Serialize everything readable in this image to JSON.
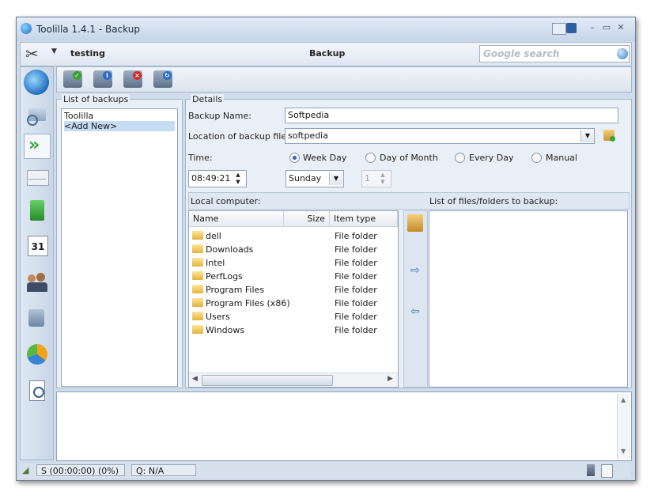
{
  "window": {
    "title": "Toolilla 1.4.1 - Backup",
    "controls": [
      "minimize",
      "maximize",
      "close"
    ]
  },
  "toolbar": {
    "profile": "testing",
    "section": "Backup",
    "search_placeholder": "Google search"
  },
  "nav": {
    "icons": [
      "app-logo-icon",
      "system-info-icon",
      "backup-arrows-icon",
      "mail-icon",
      "notes-icon",
      "calendar-icon",
      "contacts-icon",
      "network-icon",
      "pie-chart-icon",
      "document-search-icon"
    ]
  },
  "actions": {
    "icons": [
      "add-backup-icon",
      "info-backup-icon",
      "delete-backup-icon",
      "run-backup-icon"
    ]
  },
  "backups": {
    "title": "List of backups",
    "items": [
      "Toolilla",
      "<Add New>"
    ],
    "selected_index": 1
  },
  "details": {
    "title": "Details",
    "backup_name_label": "Backup Name:",
    "backup_name_value": "Softpedia",
    "location_label": "Location of backup files:",
    "location_value": "softpedia",
    "time_label": "Time:",
    "radios": [
      "Week Day",
      "Day of Month",
      "Every Day",
      "Manual"
    ],
    "selected_radio": "Week Day",
    "time_value": "08:49:21",
    "weekday_value": "Sunday",
    "day_value": "1"
  },
  "local": {
    "title": "Local computer:",
    "columns": [
      "Name",
      "Size",
      "Item type"
    ],
    "rows": [
      {
        "name": "dell",
        "type": "File folder"
      },
      {
        "name": "Downloads",
        "type": "File folder"
      },
      {
        "name": "Intel",
        "type": "File folder"
      },
      {
        "name": "PerfLogs",
        "type": "File folder"
      },
      {
        "name": "Program Files",
        "type": "File folder"
      },
      {
        "name": "Program Files (x86)",
        "type": "File folder"
      },
      {
        "name": "Users",
        "type": "File folder"
      },
      {
        "name": "Windows",
        "type": "File folder"
      }
    ]
  },
  "targets": {
    "title": "List of files/folders to backup:"
  },
  "status": {
    "progress": "S (00:00:00) (0%)",
    "queue": "Q: N/A"
  },
  "colors": {
    "window_bg": "#cfdceb",
    "selection": "#c4dcf4",
    "accent": "#2f66b3"
  }
}
